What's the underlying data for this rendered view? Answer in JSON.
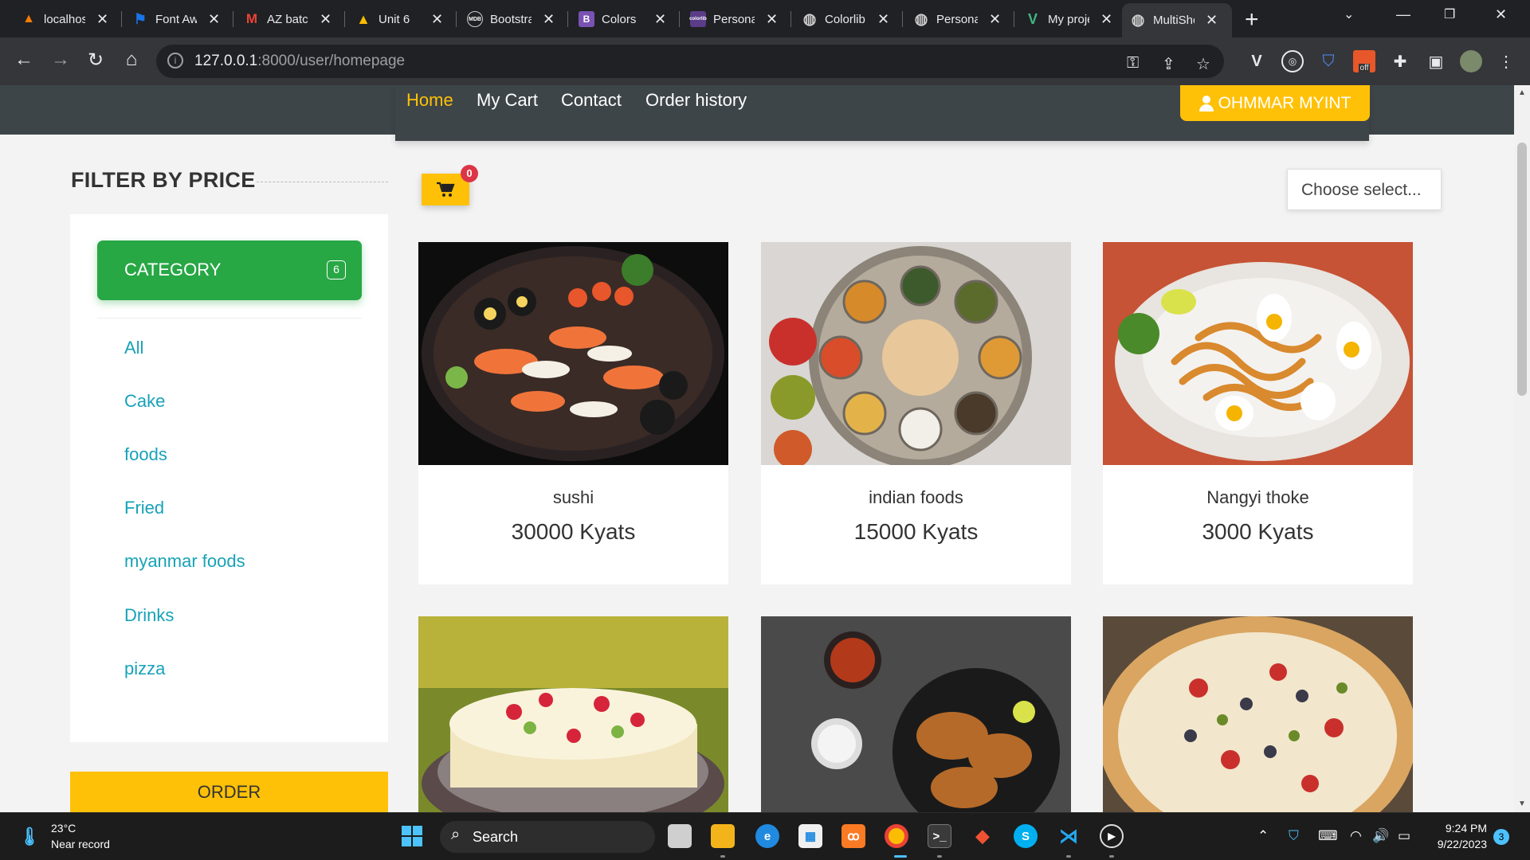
{
  "browser": {
    "tabs": [
      {
        "title": "localhost",
        "color": "#f57c00",
        "glyph": "▲"
      },
      {
        "title": "Font Awesome",
        "color": "#1a73e8",
        "glyph": "⚑"
      },
      {
        "title": "AZ batch",
        "color": "#ea4335",
        "glyph": "M"
      },
      {
        "title": "Unit 6",
        "color": "#fbbc04",
        "glyph": "▲"
      },
      {
        "title": "Bootstrap",
        "color": "#555555",
        "glyph": "◉"
      },
      {
        "title": "Colors",
        "color": "#7952b3",
        "glyph": "B"
      },
      {
        "title": "Personal",
        "color": "#6f42c1",
        "glyph": "c"
      },
      {
        "title": "Colorlib",
        "color": "#777777",
        "glyph": "◍"
      },
      {
        "title": "Personal",
        "color": "#777777",
        "glyph": "◍"
      },
      {
        "title": "My project",
        "color": "#41b883",
        "glyph": "V"
      },
      {
        "title": "MultiShop",
        "color": "#777777",
        "glyph": "◍"
      }
    ],
    "url_host": "127.0.0.1",
    "url_path": ":8000/user/homepage",
    "ext_off_label": "off"
  },
  "nav": {
    "links": [
      "Home",
      "My Cart",
      "Contact",
      "Order history"
    ],
    "user_label": "OHMMAR MYINT"
  },
  "sidebar": {
    "filter_title": "FILTER BY PRICE",
    "category_label": "CATEGORY",
    "category_count": "6",
    "categories": [
      "All",
      "Cake",
      "foods",
      "Fried",
      "myanmar foods",
      "Drinks",
      "pizza"
    ],
    "order_label": "ORDER"
  },
  "cart": {
    "count": "0"
  },
  "select": {
    "label": "Choose select..."
  },
  "products": [
    {
      "name": "sushi",
      "price": "30000 Kyats"
    },
    {
      "name": "indian foods",
      "price": "15000 Kyats"
    },
    {
      "name": "Nangyi thoke",
      "price": "3000 Kyats"
    },
    {
      "name": "",
      "price": ""
    },
    {
      "name": "",
      "price": ""
    },
    {
      "name": "",
      "price": ""
    }
  ],
  "taskbar": {
    "weather_temp": "23°C",
    "weather_desc": "Near record",
    "search_label": "Search",
    "time": "9:24 PM",
    "date": "9/22/2023",
    "notifications": "3"
  },
  "colors": {
    "accent": "#ffc107",
    "success": "#28a745",
    "link": "#17a2b8",
    "nav_bg": "#3e4549"
  }
}
